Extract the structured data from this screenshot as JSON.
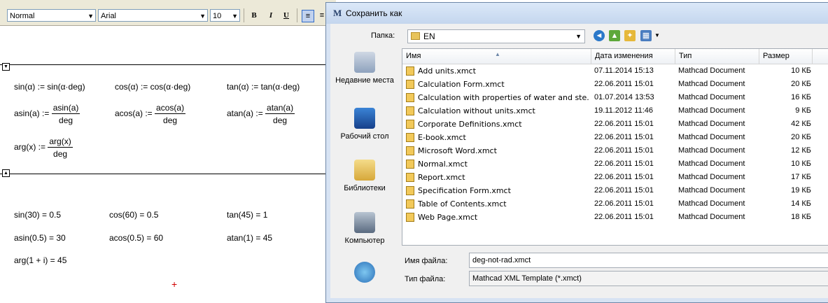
{
  "toolbar": {
    "style": "Normal",
    "font": "Arial",
    "size": "10",
    "bold": "B",
    "italic": "I",
    "underline": "U"
  },
  "worksheet": {
    "collapse_top": "▼",
    "collapse_bottom": "▲",
    "defs": {
      "sin": "sin(α) := sin(α·deg)",
      "cos": "cos(α) := cos(α·deg)",
      "tan": "tan(α) := tan(α·deg)",
      "asin_lhs": "asin(a) :=",
      "asin_num": "asin(a)",
      "acos_lhs": "acos(a) :=",
      "acos_num": "acos(a)",
      "atan_lhs": "atan(a) :=",
      "atan_num": "atan(a)",
      "arg_lhs": "arg(x) :=",
      "arg_num": "arg(x)",
      "den": "deg"
    },
    "results": {
      "sin": "sin(30) = 0.5",
      "cos": "cos(60) = 0.5",
      "tan": "tan(45) = 1",
      "asin": "asin(0.5) = 30",
      "acos": "acos(0.5) = 60",
      "atan": "atan(1) = 45",
      "arg": "arg(1 + i) = 45"
    },
    "cursor": "+"
  },
  "dialog": {
    "title": "Сохранить как",
    "title_icon": "M",
    "folder_label": "Папка:",
    "folder_value": "EN",
    "places": [
      {
        "label": "Недавние места",
        "icon": "recent-places-icon"
      },
      {
        "label": "Рабочий стол",
        "icon": "desktop-icon"
      },
      {
        "label": "Библиотеки",
        "icon": "libraries-icon"
      },
      {
        "label": "Компьютер",
        "icon": "computer-icon"
      },
      {
        "label": "",
        "icon": "network-icon"
      }
    ],
    "columns": {
      "name": "Имя",
      "date": "Дата изменения",
      "type": "Тип",
      "size": "Размер"
    },
    "files": [
      {
        "name": "Add units.xmct",
        "date": "07.11.2014 15:13",
        "type": "Mathcad Document",
        "size": "10 КБ"
      },
      {
        "name": "Calculation Form.xmct",
        "date": "22.06.2011 15:01",
        "type": "Mathcad Document",
        "size": "20 КБ"
      },
      {
        "name": "Calculation with properties of water and ste...",
        "date": "01.07.2014 13:53",
        "type": "Mathcad Document",
        "size": "16 КБ"
      },
      {
        "name": "Calculation without units.xmct",
        "date": "19.11.2012 11:46",
        "type": "Mathcad Document",
        "size": "9 КБ"
      },
      {
        "name": "Corporate Definitions.xmct",
        "date": "22.06.2011 15:01",
        "type": "Mathcad Document",
        "size": "42 КБ"
      },
      {
        "name": "E-book.xmct",
        "date": "22.06.2011 15:01",
        "type": "Mathcad Document",
        "size": "20 КБ"
      },
      {
        "name": "Microsoft Word.xmct",
        "date": "22.06.2011 15:01",
        "type": "Mathcad Document",
        "size": "12 КБ"
      },
      {
        "name": "Normal.xmct",
        "date": "22.06.2011 15:01",
        "type": "Mathcad Document",
        "size": "10 КБ"
      },
      {
        "name": "Report.xmct",
        "date": "22.06.2011 15:01",
        "type": "Mathcad Document",
        "size": "17 КБ"
      },
      {
        "name": "Specification Form.xmct",
        "date": "22.06.2011 15:01",
        "type": "Mathcad Document",
        "size": "19 КБ"
      },
      {
        "name": "Table of Contents.xmct",
        "date": "22.06.2011 15:01",
        "type": "Mathcad Document",
        "size": "14 КБ"
      },
      {
        "name": "Web Page.xmct",
        "date": "22.06.2011 15:01",
        "type": "Mathcad Document",
        "size": "18 КБ"
      }
    ],
    "filename_label": "Имя файла:",
    "filename_value": "deg-not-rad.xmct",
    "filetype_label": "Тип файла:",
    "filetype_value": "Mathcad XML Template (*.xmct)"
  }
}
